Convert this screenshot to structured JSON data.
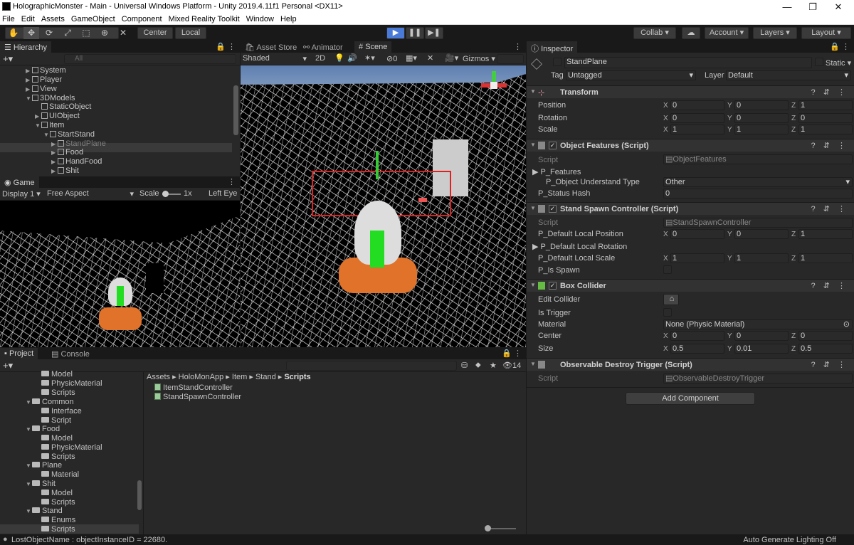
{
  "window": {
    "title": "HolographicMonster - Main - Universal Windows Platform - Unity 2019.4.11f1 Personal <DX11>"
  },
  "menu": [
    "File",
    "Edit",
    "Assets",
    "GameObject",
    "Component",
    "Mixed Reality Toolkit",
    "Window",
    "Help"
  ],
  "toolbar": {
    "center_label": "Center",
    "local_label": "Local",
    "collab_label": "Collab",
    "account_label": "Account",
    "layers_label": "Layers",
    "layout_label": "Layout"
  },
  "hierarchy": {
    "tab": "Hierarchy",
    "search_placeholder": "All",
    "items": [
      {
        "label": "System",
        "indent": 2,
        "tri": "▶"
      },
      {
        "label": "Player",
        "indent": 2,
        "tri": "▶"
      },
      {
        "label": "View",
        "indent": 2,
        "tri": "▶"
      },
      {
        "label": "3DModels",
        "indent": 2,
        "tri": "▼"
      },
      {
        "label": "StaticObject",
        "indent": 3,
        "tri": ""
      },
      {
        "label": "UIObject",
        "indent": 3,
        "tri": "▶"
      },
      {
        "label": "Item",
        "indent": 3,
        "tri": "▼"
      },
      {
        "label": "StartStand",
        "indent": 4,
        "tri": "▼"
      },
      {
        "label": "StandPlane",
        "indent": 5,
        "tri": "▶",
        "selected": true
      },
      {
        "label": "Food",
        "indent": 4,
        "tri": "▶"
      },
      {
        "label": "HandFood",
        "indent": 4,
        "tri": "▶"
      },
      {
        "label": "Shit",
        "indent": 4,
        "tri": "▶"
      }
    ]
  },
  "game": {
    "tab": "Game",
    "display": "Display 1",
    "aspect": "Free Aspect",
    "scale_label": "Scale",
    "scale_value": "1x",
    "eye": "Left Eye"
  },
  "scene": {
    "tabs": [
      "Asset Store",
      "Animator",
      "Scene"
    ],
    "shading": "Shaded",
    "mode_2d": "2D",
    "gizmos": "Gizmos",
    "fx_count": "0"
  },
  "project": {
    "tabs": [
      "Project",
      "Console"
    ],
    "tree": [
      {
        "label": "Model",
        "indent": 4,
        "tri": ""
      },
      {
        "label": "PhysicMaterial",
        "indent": 4,
        "tri": ""
      },
      {
        "label": "Scripts",
        "indent": 4,
        "tri": ""
      },
      {
        "label": "Common",
        "indent": 3,
        "tri": "▼"
      },
      {
        "label": "Interface",
        "indent": 4,
        "tri": ""
      },
      {
        "label": "Script",
        "indent": 4,
        "tri": ""
      },
      {
        "label": "Food",
        "indent": 3,
        "tri": "▼"
      },
      {
        "label": "Model",
        "indent": 4,
        "tri": ""
      },
      {
        "label": "PhysicMaterial",
        "indent": 4,
        "tri": ""
      },
      {
        "label": "Scripts",
        "indent": 4,
        "tri": ""
      },
      {
        "label": "Plane",
        "indent": 3,
        "tri": "▼"
      },
      {
        "label": "Material",
        "indent": 4,
        "tri": ""
      },
      {
        "label": "Shit",
        "indent": 3,
        "tri": "▼"
      },
      {
        "label": "Model",
        "indent": 4,
        "tri": ""
      },
      {
        "label": "Scripts",
        "indent": 4,
        "tri": ""
      },
      {
        "label": "Stand",
        "indent": 3,
        "tri": "▼"
      },
      {
        "label": "Enums",
        "indent": 4,
        "tri": ""
      },
      {
        "label": "Scripts",
        "indent": 4,
        "tri": "",
        "selected": true
      }
    ],
    "breadcrumb": [
      "Assets",
      "HoloMonApp",
      "Item",
      "Stand",
      "Scripts"
    ],
    "files": [
      "ItemStandController",
      "StandSpawnController"
    ],
    "badge_count": "14"
  },
  "inspector": {
    "tab": "Inspector",
    "object_name": "StandPlane",
    "static_label": "Static",
    "tag_label": "Tag",
    "tag_value": "Untagged",
    "layer_label": "Layer",
    "layer_value": "Default",
    "transform": {
      "name": "Transform",
      "pos_label": "Position",
      "rot_label": "Rotation",
      "scale_label": "Scale",
      "pos": [
        "0",
        "0",
        "1"
      ],
      "rot": [
        "0",
        "0",
        "0"
      ],
      "scale": [
        "1",
        "1",
        "1"
      ]
    },
    "features": {
      "name": "Object Features (Script)",
      "script_label": "Script",
      "script_value": "ObjectFeatures",
      "p_features": "P_Features",
      "understand_label": "P_Object Understand Type",
      "understand_value": "Other",
      "hash_label": "P_Status Hash",
      "hash_value": "0"
    },
    "spawn": {
      "name": "Stand Spawn Controller (Script)",
      "script_label": "Script",
      "script_value": "StandSpawnController",
      "pos_label": "P_Default Local Position",
      "pos": [
        "0",
        "0",
        "1"
      ],
      "rot_label": "P_Default Local Rotation",
      "scale_label": "P_Default Local Scale",
      "scale": [
        "1",
        "1",
        "1"
      ],
      "is_spawn_label": "P_Is Spawn"
    },
    "box": {
      "name": "Box Collider",
      "edit_label": "Edit Collider",
      "trigger_label": "Is Trigger",
      "material_label": "Material",
      "material_value": "None (Physic Material)",
      "center_label": "Center",
      "center": [
        "0",
        "0",
        "0"
      ],
      "size_label": "Size",
      "size": [
        "0.5",
        "0.01",
        "0.5"
      ]
    },
    "destroy": {
      "name": "Observable Destroy Trigger (Script)",
      "script_label": "Script",
      "script_value": "ObservableDestroyTrigger"
    },
    "add_component": "Add Component"
  },
  "status": {
    "message": "LostObjectName : objectInstanceID = 22680.",
    "lighting": "Auto Generate Lighting Off"
  },
  "colors": {
    "play_accent": "#4a7ad8",
    "selection_box": "#e02020",
    "monster_body": "#e0722a",
    "monster_core": "#22dd22"
  }
}
